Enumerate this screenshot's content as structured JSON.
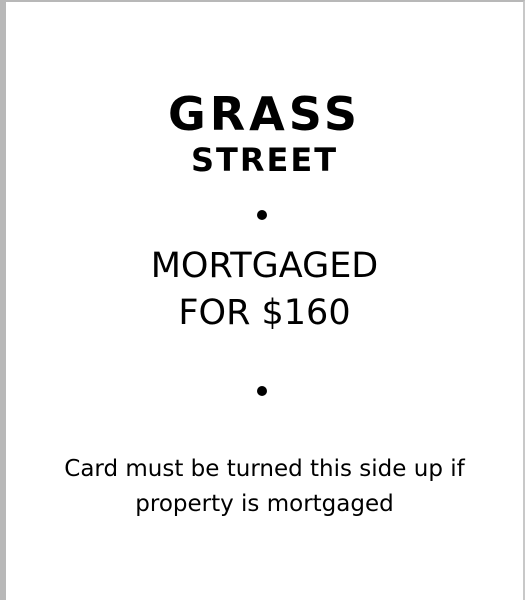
{
  "card": {
    "title_line1": "GRASS",
    "title_line2": "STREET",
    "mortgage_line1": "MORTGAGED",
    "mortgage_line2": "FOR $160",
    "note": "Card must be turned this side up if property is mortgaged"
  }
}
